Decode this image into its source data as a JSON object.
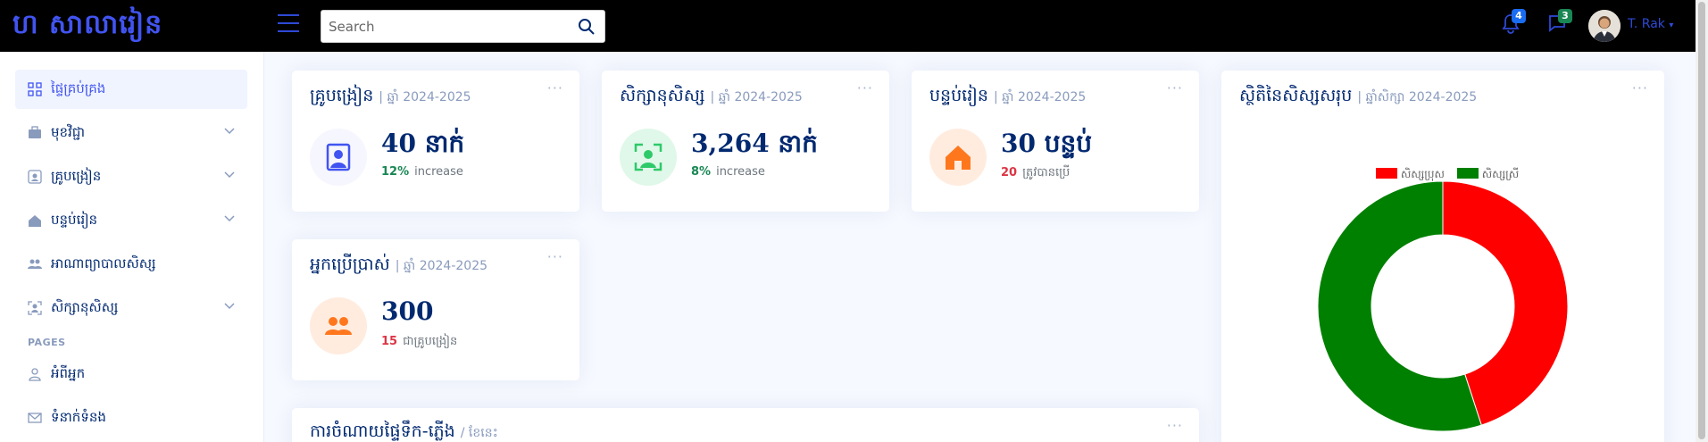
{
  "header": {
    "logo": "ហ សាលារៀន",
    "search_placeholder": "Search",
    "notifications_count": "4",
    "messages_count": "3",
    "user_name": "T. Rak",
    "avatar_icon": "user-avatar-photo",
    "colors": {
      "bg": "#000000",
      "accent": "#4154f1",
      "notif_badge": "#1a6cf0",
      "msg_badge": "#198754"
    }
  },
  "sidebar": {
    "items": [
      {
        "label": "ផ្ទៃគ្រប់គ្រង",
        "icon": "grid-icon",
        "expandable": false,
        "active": true
      },
      {
        "label": "មុខវិជ្ជា",
        "icon": "briefcase-icon",
        "expandable": true
      },
      {
        "label": "គ្រូបង្រៀន",
        "icon": "person-badge-icon",
        "expandable": true
      },
      {
        "label": "បន្ទប់រៀន",
        "icon": "house-icon",
        "expandable": true
      },
      {
        "label": "អាណាព្យាបាលសិស្ស",
        "icon": "people-icon",
        "expandable": false
      },
      {
        "label": "សិក្សានុសិស្ស",
        "icon": "person-bounding-icon",
        "expandable": true
      }
    ],
    "pages_heading": "PAGES",
    "page_items": [
      {
        "label": "អំពីអ្នក",
        "icon": "person-icon"
      },
      {
        "label": "ទំនាក់ទំនង",
        "icon": "envelope-icon"
      }
    ]
  },
  "cards": {
    "teachers": {
      "title": "គ្រូបង្រៀន",
      "sub": "| ឆ្នាំ 2024-2025",
      "value": "40 នាក់",
      "pct": "12%",
      "foot": "increase",
      "icon": "teacher-board-icon",
      "color": "#4154f1",
      "bg": "#f6f6fe"
    },
    "students": {
      "title": "សិក្សានុសិស្ស",
      "sub": "| ឆ្នាំ 2024-2025",
      "value": "3,264 នាក់",
      "pct": "8%",
      "foot": "increase",
      "icon": "person-bounding-icon",
      "color": "#2eca6a",
      "bg": "#e0f8e9"
    },
    "rooms": {
      "title": "បន្ទប់រៀន",
      "sub": "| ឆ្នាំ 2024-2025",
      "value": "30 បន្ទប់",
      "pct": "20",
      "foot": "ត្រូវបានប្រើ",
      "icon": "house-icon",
      "color": "#ff771d",
      "bg": "#ffecdf"
    },
    "users": {
      "title": "អ្នកប្រើប្រាស់",
      "sub": "| ឆ្នាំ 2024-2025",
      "value": "300",
      "pct": "15",
      "foot": "ជាគ្រូបង្រៀន",
      "icon": "people-icon",
      "color": "#ff771d",
      "bg": "#ffecdf"
    },
    "expense": {
      "title": "ការចំណាយផ្ទៃទឹក-ភ្លើង",
      "sub": "/ ខែនេះ"
    },
    "chart": {
      "title": "ស្ថិតិនៃសិស្សសរុប",
      "sub": "| ឆ្នាំសិក្សា 2024-2025"
    },
    "more_label": "···"
  },
  "chart_data": {
    "type": "pie",
    "style": "doughnut",
    "categories": [
      "សិស្សប្រុស",
      "សិស្សស្រី"
    ],
    "values": [
      45,
      55
    ],
    "colors": [
      "#ff0000",
      "#008000"
    ],
    "legend": "top"
  }
}
